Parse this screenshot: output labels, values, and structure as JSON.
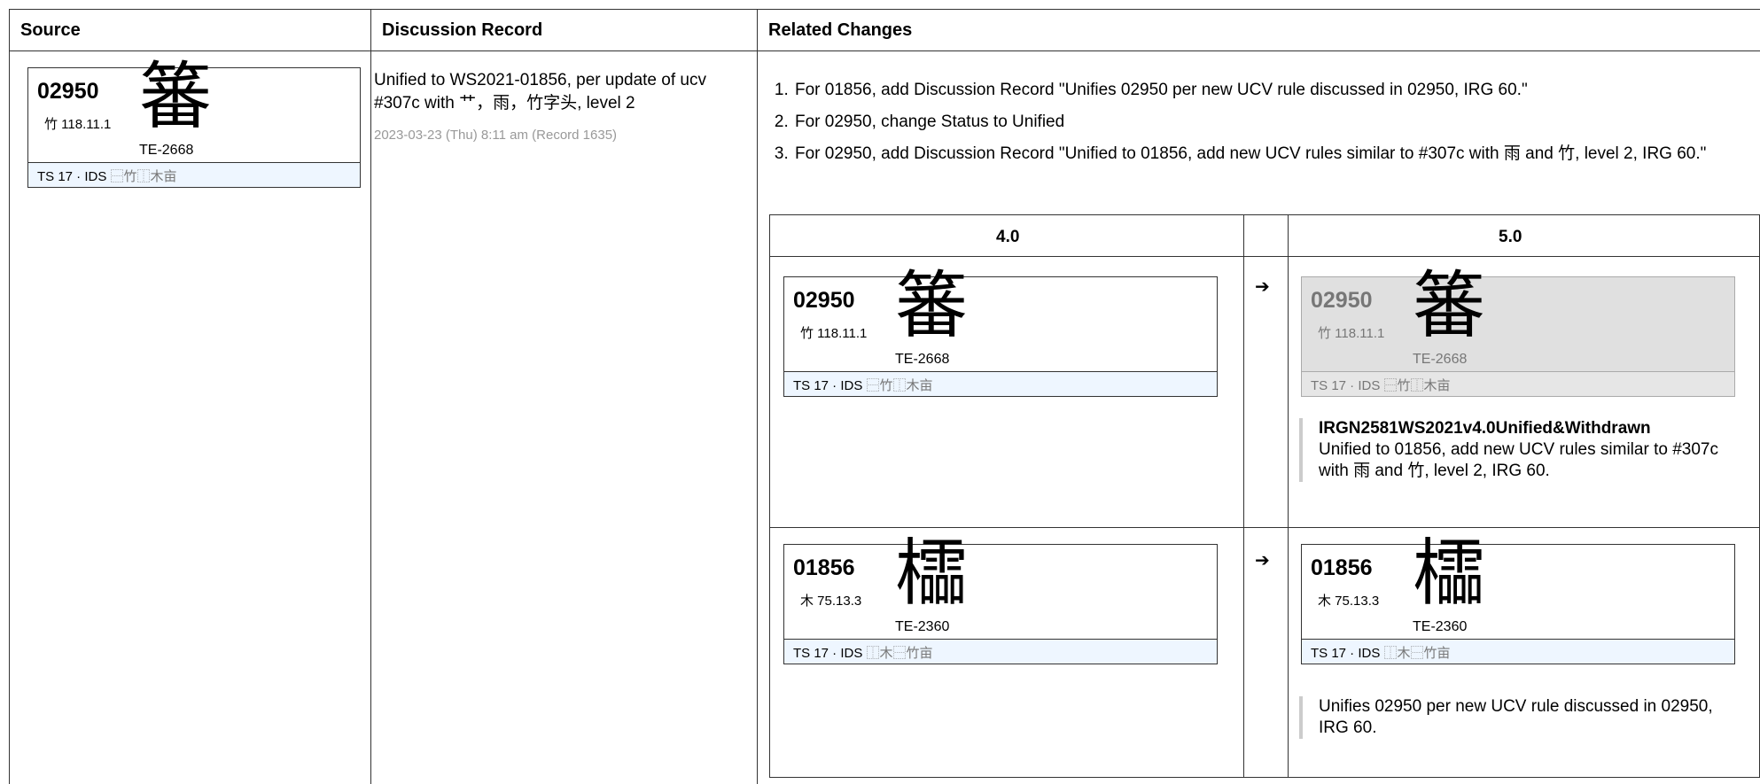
{
  "headers": {
    "source": "Source",
    "discussion": "Discussion Record",
    "related": "Related Changes"
  },
  "cards": {
    "c02950": {
      "code": "02950",
      "radical": "竹 118.11.1",
      "glyph": "䉒",
      "te": "TE-2668",
      "ts": "TS 17 · IDS",
      "ids": "⿱竹⿰木亩"
    },
    "c01856": {
      "code": "01856",
      "radical": "木 75.13.3",
      "glyph": "櫺",
      "te": "TE-2360",
      "ts": "TS 17 · IDS",
      "ids": "⿰木⿱竹亩"
    }
  },
  "discussion": {
    "text": "Unified to WS2021-01856, per update of ucv #307c with 艹，雨，竹字头, level 2",
    "meta": "2023-03-23 (Thu) 8:11 am (Record 1635)"
  },
  "related": {
    "items": [
      "For 01856, add Discussion Record \"Unifies 02950 per new UCV rule discussed in 02950, IRG 60.\"",
      "For 02950, change Status to Unified",
      "For 02950, add Discussion Record \"Unified to 01856, add new UCV rules similar to #307c with 雨 and 竹, level 2, IRG 60.\""
    ],
    "v4_label": "4.0",
    "v5_label": "5.0",
    "arrow": "➔",
    "note1_title": "IRGN2581WS2021v4.0Unified&Withdrawn",
    "note1_text": "Unified to 01856, add new UCV rules similar to #307c with 雨 and 竹, level 2, IRG 60.",
    "note2_text": "Unifies 02950 per new UCV rule discussed in 02950, IRG 60."
  }
}
